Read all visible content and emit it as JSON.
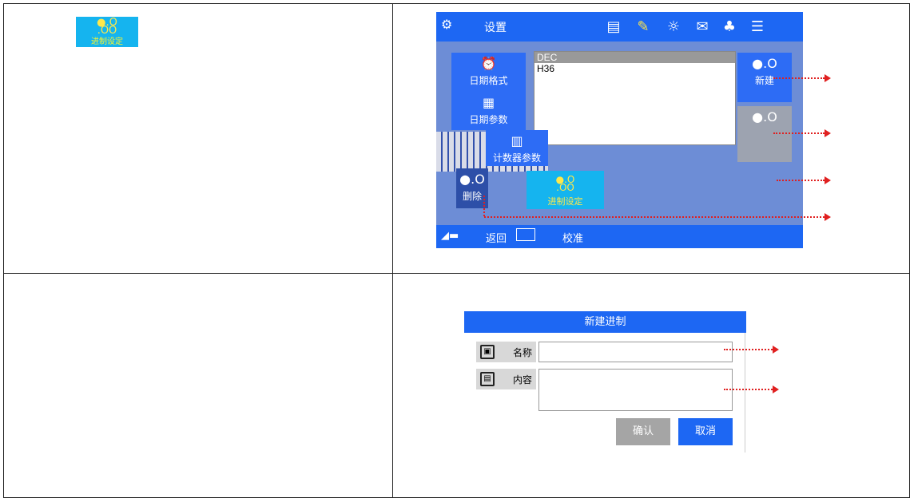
{
  "thumbnail": {
    "icon": "←.O\n.OO",
    "label": "进制设定"
  },
  "screen": {
    "title": "设置",
    "list_items": [
      "DEC",
      "H36"
    ],
    "left_buttons": [
      "日期格式",
      "日期参数",
      "计数器参数"
    ],
    "right_buttons": {
      "new": "新建",
      "delete_partial": "删除"
    },
    "overlay_label": "进制设定",
    "bottom": {
      "back": "返回",
      "calibrate": "校准"
    }
  },
  "dialog": {
    "title": "新建进制",
    "name_label": "名称",
    "content_label": "内容",
    "name_value": "",
    "content_value": "",
    "confirm": "确认",
    "cancel": "取消"
  },
  "colors": {
    "accent": "#1d67f3",
    "overlay": "#15b4ef",
    "arrow": "#e02020"
  }
}
